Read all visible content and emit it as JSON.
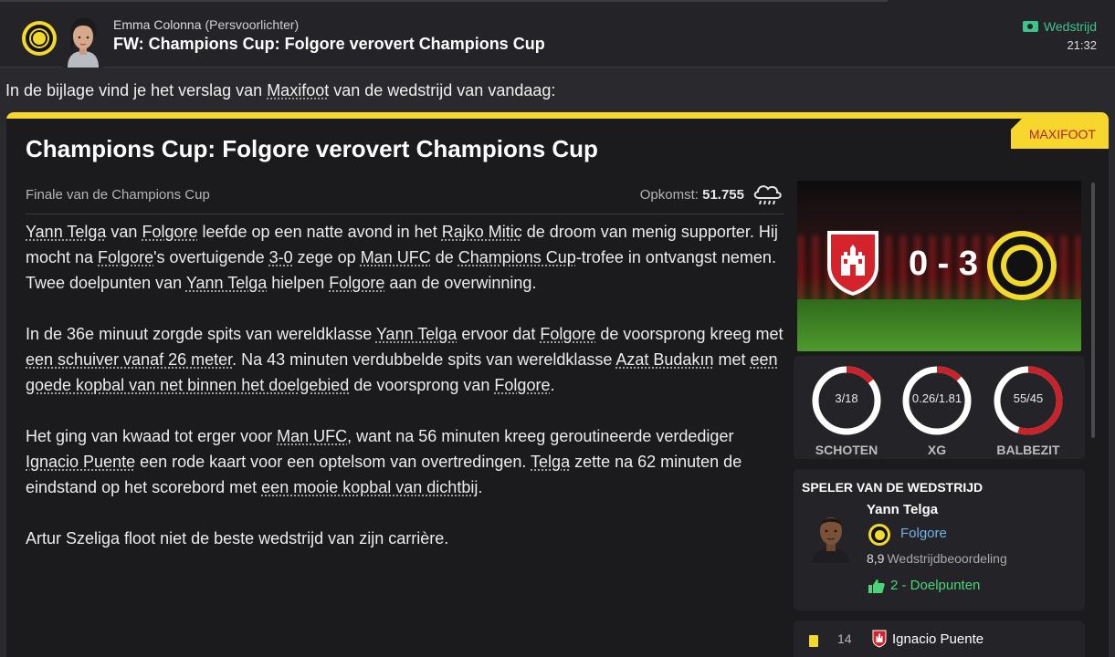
{
  "header": {
    "sender_name": "Emma Colonna",
    "sender_role": "(Persvoorlichter)",
    "subject": "FW: Champions Cup: Folgore verovert Champions Cup",
    "tag": "Wedstrijd",
    "time": "21:32",
    "tag_color": "#3ec38a"
  },
  "intro": {
    "before": "In de bijlage vind je het verslag van ",
    "link": "Maxifoot",
    "after": " van de wedstrijd van vandaag:"
  },
  "article": {
    "source": "MAXIFOOT",
    "title": "Champions Cup: Folgore verovert Champions Cup",
    "competition": "Finale van de Champions Cup",
    "attendance_label": "Opkomst:",
    "attendance_value": "51.755",
    "weather_icon": "rain-cloud-icon",
    "p1": {
      "a": "Yann Telga",
      "b": " van ",
      "c": "Folgore",
      "d": " leefde op een natte avond in het ",
      "e": "Rajko Mitic",
      "f": " de droom van menig supporter. Hij mocht na ",
      "g": "Folgore",
      "h": "'s overtuigende ",
      "i": "3-0",
      "j": " zege op ",
      "k": "Man UFC",
      "l": " de ",
      "m": "Champions Cup",
      "n": "-trofee in ontvangst nemen. Twee doelpunten van ",
      "o": "Yann Telga",
      "p": " hielpen ",
      "q": "Folgore",
      "r": " aan de overwinning."
    },
    "p2": {
      "a": "In de 36e minuut zorgde spits van wereldklasse ",
      "b": "Yann Telga",
      "c": " ervoor dat ",
      "d": "Folgore",
      "e": " de voorsprong kreeg met ",
      "f": "een schuiver vanaf 26 meter",
      "g": ". Na 43 minuten verdubbelde spits van wereldklasse ",
      "h": "Azat Budakın",
      "i": " met ",
      "j": "een goede kopbal van net binnen het doelgebied",
      "k": " de voorsprong van ",
      "l": "Folgore",
      "m": "."
    },
    "p3": {
      "a": "Het ging van kwaad tot erger voor ",
      "b": "Man UFC",
      "c": ", want na 56 minuten kreeg geroutineerde verdediger ",
      "d": "Ignacio Puente",
      "e": " een rode kaart voor een optelsom van overtredingen. ",
      "f": "Telga",
      "g": " zette na 62 minuten de eindstand op het scorebord met ",
      "h": "een mooie kopbal van dichtbij",
      "i": "."
    },
    "p4": "Artur Szeliga floot niet de beste wedstrijd van zijn carrière."
  },
  "match": {
    "score": "0 - 3",
    "home_badge_icon": "castle-shield-icon",
    "away_badge_icon": "football-crest-icon",
    "home_color": "#d4232b",
    "away_color": "#f3d92b"
  },
  "stats": [
    {
      "label": "SCHOTEN",
      "value": "3/18",
      "home_share": 0.143
    },
    {
      "label": "XG",
      "value": "0.26/1.81",
      "home_share": 0.126
    },
    {
      "label": "BALBEZIT",
      "value": "55/45",
      "home_share": 0.55
    }
  ],
  "player_of_match": {
    "heading": "SPELER VAN DE WEDSTRIJD",
    "name": "Yann Telga",
    "club": "Folgore",
    "rating": "8,9",
    "rating_label": "Wedstrijdbeoordeling",
    "goals": "2 - Doelpunten",
    "goals_icon": "thumbs-up-icon"
  },
  "events": [
    {
      "card": "yellow-card-icon",
      "minute": "14",
      "team_icon": "castle-shield-icon",
      "player": "Ignacio Puente"
    }
  ]
}
